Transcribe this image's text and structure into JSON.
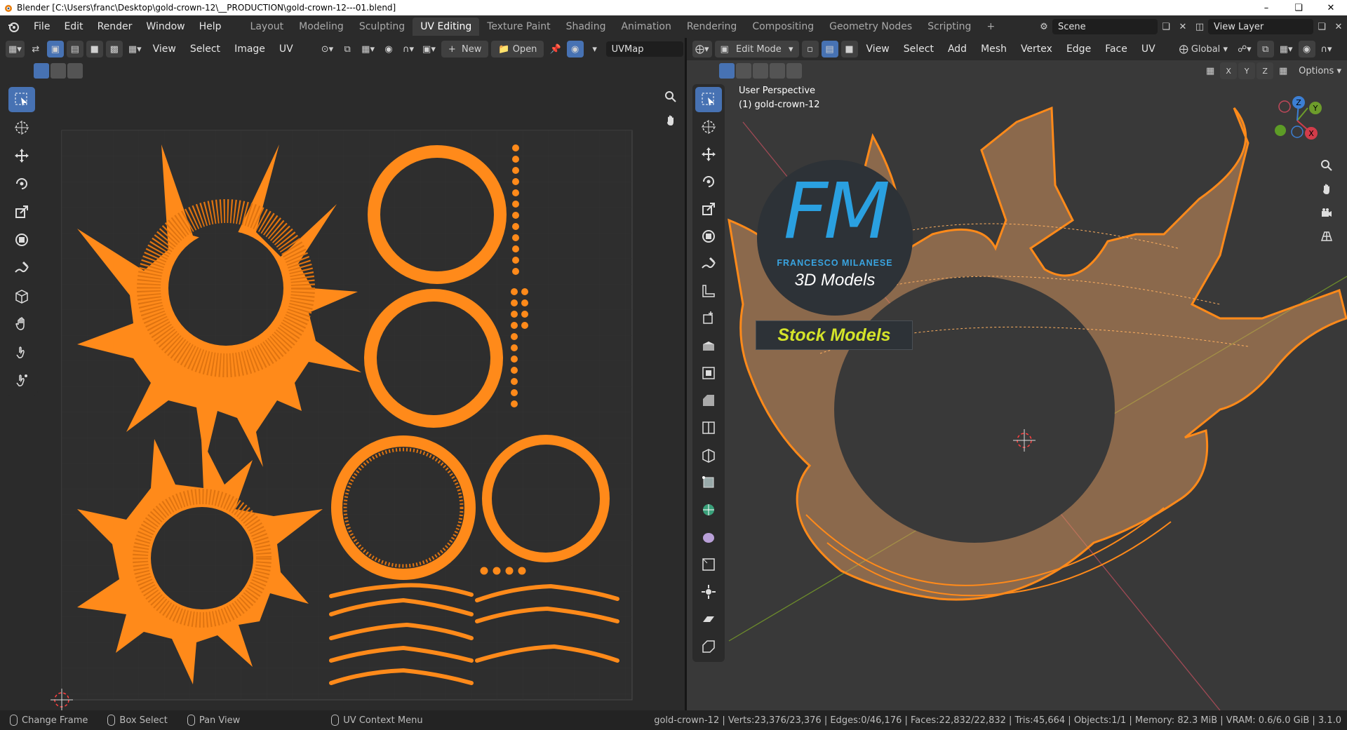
{
  "os_title": "Blender [C:\\Users\\franc\\Desktop\\gold-crown-12\\__PRODUCTION\\gold-crown-12---01.blend]",
  "menus": [
    "File",
    "Edit",
    "Render",
    "Window",
    "Help"
  ],
  "workspaces": [
    "Layout",
    "Modeling",
    "Sculpting",
    "UV Editing",
    "Texture Paint",
    "Shading",
    "Animation",
    "Rendering",
    "Compositing",
    "Geometry Nodes",
    "Scripting"
  ],
  "active_workspace": "UV Editing",
  "scene": "Scene",
  "view_layer": "View Layer",
  "uv_editor": {
    "menus": [
      "View",
      "Select",
      "Image",
      "UV"
    ],
    "new_label": "New",
    "open_label": "Open",
    "uvmap": "UVMap"
  },
  "viewport": {
    "mode": "Edit Mode",
    "menus": [
      "View",
      "Select",
      "Add",
      "Mesh",
      "Vertex",
      "Edge",
      "Face",
      "UV"
    ],
    "transform_orientation": "Global",
    "options_label": "Options",
    "axes": [
      "X",
      "Y",
      "Z"
    ],
    "perspective": "User Perspective",
    "object": "(1) gold-crown-12"
  },
  "watermark": {
    "logo": "FM",
    "line1": "FRANCESCO MILANESE",
    "line2": "3D Models",
    "badge": "Stock Models"
  },
  "status": {
    "hints": [
      "Change Frame",
      "Box Select",
      "Pan View",
      "UV Context Menu"
    ],
    "stats": "gold-crown-12 | Verts:23,376/23,376 | Edges:0/46,176 | Faces:22,832/22,832 | Tris:45,664 | Objects:1/1 | Memory: 82.3 MiB | VRAM: 0.6/6.0 GiB | 3.1.0"
  },
  "colors": {
    "accent": "#4772b3",
    "mesh": "#ff8a1a",
    "badge_text": "#d4e32a"
  }
}
